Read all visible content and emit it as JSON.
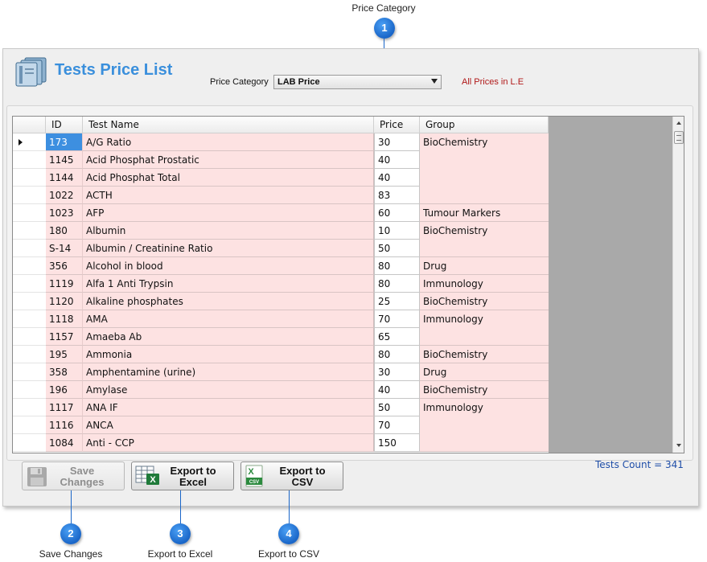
{
  "callouts": [
    {
      "num": "1",
      "label": "Price Category"
    },
    {
      "num": "2",
      "label": "Save Changes"
    },
    {
      "num": "3",
      "label": "Export to Excel"
    },
    {
      "num": "4",
      "label": "Export to CSV"
    }
  ],
  "header": {
    "title": "Tests Price List",
    "price_category_label": "Price Category",
    "price_category_value": "LAB Price",
    "prices_note": "All Prices in L.E"
  },
  "grid": {
    "columns": [
      "ID",
      "Test Name",
      "Price",
      "Group"
    ],
    "rows": [
      {
        "id": "173",
        "name": "A/G Ratio",
        "price": "30",
        "group": "BioChemistry"
      },
      {
        "id": "1145",
        "name": "Acid Phosphat Prostatic",
        "price": "40",
        "group": ""
      },
      {
        "id": "1144",
        "name": "Acid Phosphat Total",
        "price": "40",
        "group": ""
      },
      {
        "id": "1022",
        "name": "ACTH",
        "price": "83",
        "group": ""
      },
      {
        "id": "1023",
        "name": "AFP",
        "price": "60",
        "group": "Tumour Markers"
      },
      {
        "id": "180",
        "name": "Albumin",
        "price": "10",
        "group": "BioChemistry"
      },
      {
        "id": "S-14",
        "name": "Albumin / Creatinine Ratio",
        "price": "50",
        "group": ""
      },
      {
        "id": "356",
        "name": "Alcohol in blood",
        "price": "80",
        "group": "Drug"
      },
      {
        "id": "1119",
        "name": "Alfa 1 Anti Trypsin",
        "price": "80",
        "group": "Immunology"
      },
      {
        "id": "1120",
        "name": "Alkaline phosphates",
        "price": "25",
        "group": "BioChemistry"
      },
      {
        "id": "1118",
        "name": "AMA",
        "price": "70",
        "group": "Immunology"
      },
      {
        "id": "1157",
        "name": "Amaeba Ab",
        "price": "65",
        "group": ""
      },
      {
        "id": "195",
        "name": "Ammonia",
        "price": "80",
        "group": "BioChemistry"
      },
      {
        "id": "358",
        "name": "Amphentamine (urine)",
        "price": "30",
        "group": "Drug"
      },
      {
        "id": "196",
        "name": "Amylase",
        "price": "40",
        "group": "BioChemistry"
      },
      {
        "id": "1117",
        "name": "ANA IF",
        "price": "50",
        "group": "Immunology"
      },
      {
        "id": "1116",
        "name": "ANCA",
        "price": "70",
        "group": ""
      },
      {
        "id": "1084",
        "name": "Anti - CCP",
        "price": "150",
        "group": ""
      }
    ]
  },
  "footer": {
    "tests_count": "Tests Count = 341",
    "save_label_1": "Save",
    "save_label_2": "Changes",
    "excel_label_1": "Export to",
    "excel_label_2": "Excel",
    "csv_label_1": "Export to",
    "csv_label_2": "CSV",
    "csv_icon_text": "CSV"
  },
  "colors": {
    "title": "#3a8fdc",
    "row_pink": "#fde2e2",
    "selected_cell": "#3d8fe0",
    "note_red": "#b01818",
    "callout_blue": "#1a66c8"
  }
}
